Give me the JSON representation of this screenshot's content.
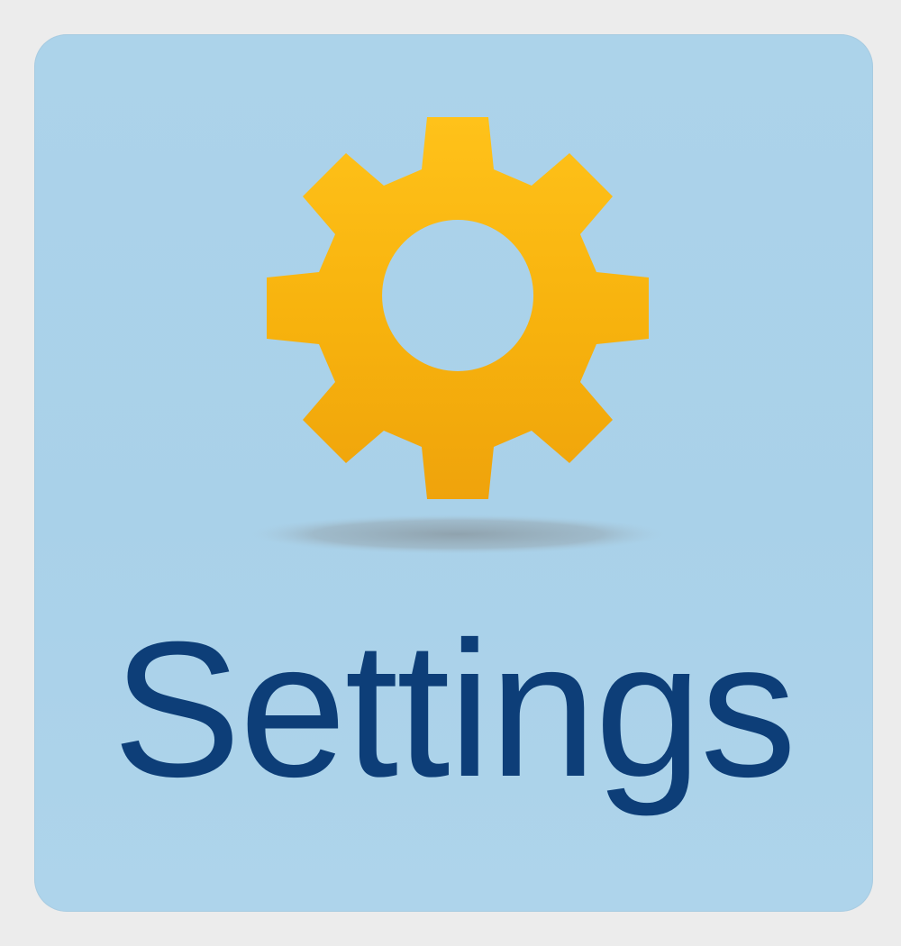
{
  "tile": {
    "label": "Settings",
    "icon": "gear-icon",
    "background_color": "#acd3ea",
    "label_color": "#0d3e78",
    "icon_color": "#f7b10a"
  }
}
